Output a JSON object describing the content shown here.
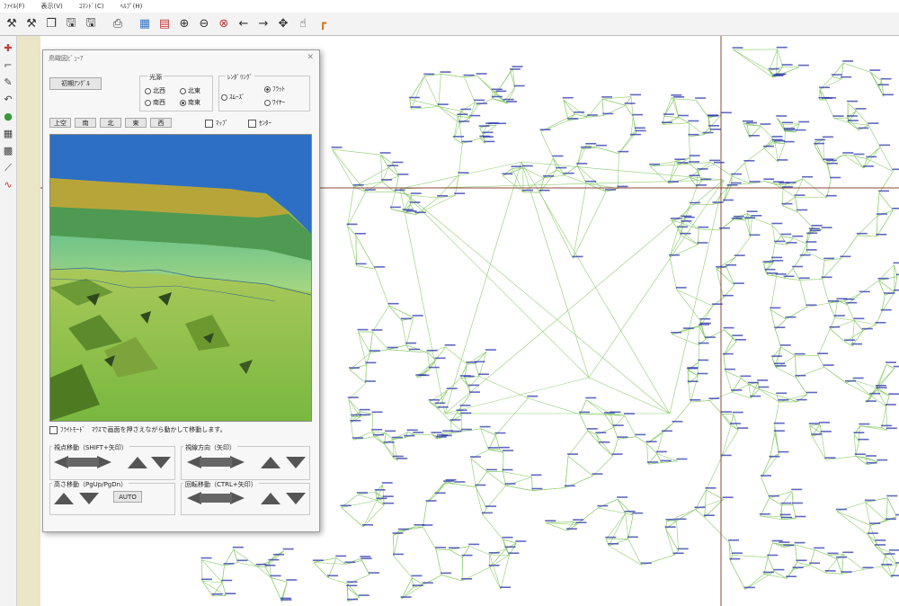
{
  "menu": {
    "items": [
      "ﾌｧｲﾙ(F)",
      "表示(V)",
      "ｺﾏﾝﾄﾞ(C)",
      "ﾍﾙﾌﾟ(H)"
    ]
  },
  "toolbar": {
    "icons": [
      "survey-icon",
      "survey-alt-icon",
      "copy-icon",
      "save-icon",
      "save-as-icon",
      "print-icon",
      "map-icon",
      "layers-icon",
      "zoom-in-icon",
      "zoom-out-icon",
      "zoom-fit-icon",
      "arrow-left-icon",
      "arrow-right-icon",
      "pan-icon",
      "hand-icon",
      "corner-icon"
    ]
  },
  "dialog": {
    "title": "鳥瞰図ﾋﾞｭｰｱ",
    "close": "✕",
    "init_button": "初期ｱﾝｸﾞﾙ",
    "light_source_label": "光源",
    "light_options": [
      "北西",
      "北東",
      "南西",
      "南東"
    ],
    "light_selected": "南東",
    "rendering_label": "ﾚﾝﾀﾞﾘﾝｸﾞ",
    "render_options": [
      "ﾌﾗｯﾄ",
      "ｽﾑｰｽﾞ",
      "ﾜｲﾔｰ"
    ],
    "render_selected": "ﾌﾗｯﾄ",
    "view_buttons": [
      "上空",
      "南",
      "北",
      "東",
      "西"
    ],
    "map_checkbox": "ﾏｯﾌﾟ",
    "center_checkbox": "ｾﾝﾀｰ",
    "flight_mode_text": "ﾌﾗｲﾄﾓｰﾄﾞ　ﾏｳｽで画面を押さえながら動かして移動します。",
    "group_viewpoint_move": "視点移動（SHIFT+矢印）",
    "group_view_direction": "視線方向（矢印）",
    "group_height": "高さ移動（PgUp/PgDn）",
    "group_rotate": "回転移動（CTRL+矢印）",
    "auto_button": "AUTO"
  },
  "colors": {
    "tin_lines": "#8ccc6e",
    "point_labels": "#2a36a8",
    "crosshair": "#8b4a3a",
    "sky": "#2d6fc4"
  }
}
